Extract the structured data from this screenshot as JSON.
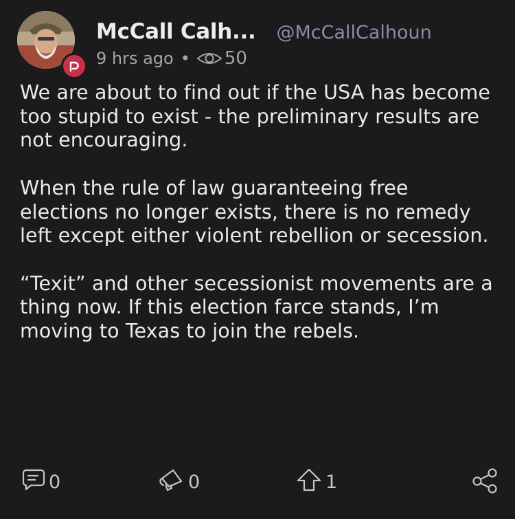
{
  "author": {
    "display_name": "McCall Calh...",
    "handle": "@McCallCalhoun",
    "avatar_icon": "user-avatar",
    "badge_icon": "parler-badge-icon",
    "badge_color": "#c5334a"
  },
  "meta": {
    "time": "9 hrs ago",
    "separator": "•",
    "views": "50"
  },
  "post": {
    "paragraphs": [
      "We are about to find out if the USA has become too stupid to exist - the preliminary results are not encouraging.",
      "When the rule of law guaranteeing free elections no longer exists, there is no remedy left except either violent rebellion or secession.",
      "“Texit” and other secessionist movements are a thing now. If this election farce stands, I’m moving to Texas to join the rebels."
    ]
  },
  "actions": {
    "comments": "0",
    "echoes": "0",
    "upvotes": "1"
  },
  "colors": {
    "background": "#1b1b1c",
    "text": "#eaeaea",
    "handle": "#8f89a8",
    "muted": "#a5a5a8"
  }
}
